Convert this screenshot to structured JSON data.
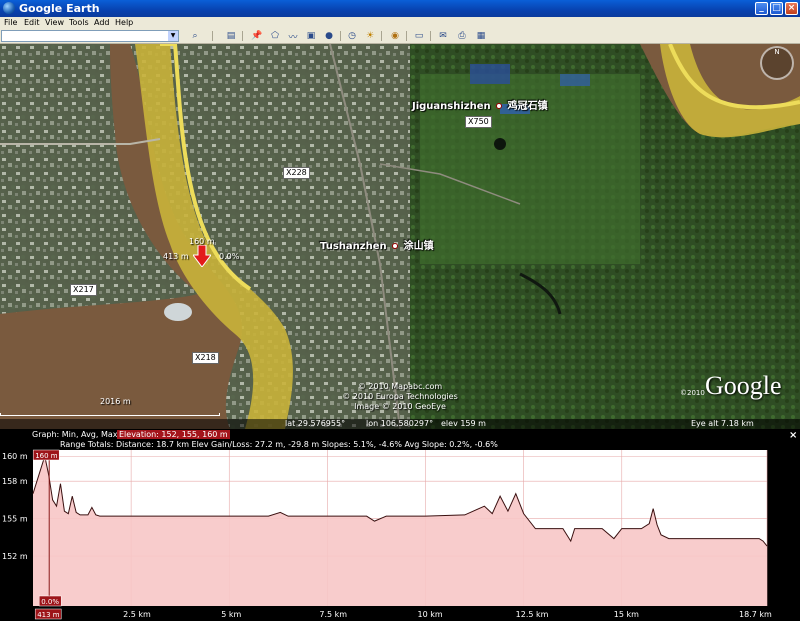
{
  "window": {
    "title": "Google Earth"
  },
  "menu": [
    "File",
    "Edit",
    "View",
    "Tools",
    "Add",
    "Help"
  ],
  "toolbar": {
    "search_value": "",
    "icons": [
      "search-icon",
      "sidebar-icon",
      "placemark-icon",
      "polygon-icon",
      "path-icon",
      "overlay-icon",
      "tour-icon",
      "history-icon",
      "sun-icon",
      "planet-icon",
      "ruler-icon",
      "email-icon",
      "print-icon",
      "maps-icon"
    ]
  },
  "map": {
    "places": [
      {
        "name": "Jiguanshizhen",
        "cn": "鸡冠石镇"
      },
      {
        "name": "Tushanzhen",
        "cn": "涂山镇"
      }
    ],
    "roads": [
      "X750",
      "X228",
      "X217",
      "X218"
    ],
    "marker": {
      "elevation": "160 m",
      "distance": "413 m",
      "slope": "0.0%"
    },
    "year_label": "2016 m",
    "credits": [
      "© 2010 Mapabc.com",
      "© 2010 Europa Technologies",
      "Image © 2010 GeoEye"
    ],
    "logo": "Google",
    "logo_year": "©2010",
    "compass_label": "N",
    "status": {
      "lat": "lat  29.576955°",
      "lon": "lon 106.580297°",
      "elev": "elev  159 m",
      "eye": "Eye alt    7.18 km"
    }
  },
  "elevation_panel": {
    "graph_line": "Graph: Min, Avg, Max",
    "graph_highlight": "Elevation: 152, 155, 160 m",
    "range_totals": "Range Totals: Distance: 18.7 km  Elev Gain/Loss: 27.2 m, -29.8 m  Slopes: 5.1%, -4.6%  Avg Slope: 0.2%, -0.6%",
    "cursor_top": "160 m",
    "cursor_bottom": "0.0%",
    "cursor_x": "413 m",
    "colors": {
      "fill": "#f7c6c6",
      "line": "#3a1010",
      "grid": "#e7a9a9"
    }
  },
  "chart_data": {
    "type": "area",
    "xlabel": "",
    "ylabel": "",
    "x_ticks": [
      "413 m",
      "2.5 km",
      "5 km",
      "7.5 km",
      "10 km",
      "12.5 km",
      "15 km",
      "18.7 km"
    ],
    "y_ticks": [
      "160 m",
      "158 m",
      "155 m",
      "152 m"
    ],
    "ylim": [
      148,
      160.5
    ],
    "xlim": [
      0,
      18.7
    ],
    "series": [
      {
        "name": "Elevation",
        "x": [
          0,
          0.15,
          0.3,
          0.4,
          0.5,
          0.6,
          0.7,
          0.8,
          0.9,
          1.0,
          1.1,
          1.2,
          1.3,
          1.4,
          1.5,
          1.6,
          1.7,
          2.0,
          3.0,
          4.0,
          5.0,
          6.0,
          6.3,
          6.5,
          7.0,
          7.5,
          8.0,
          8.5,
          8.7,
          9.0,
          10.0,
          11.0,
          11.5,
          11.7,
          11.9,
          12.1,
          12.3,
          12.5,
          12.8,
          13.5,
          13.7,
          13.8,
          14.0,
          14.5,
          14.8,
          15.0,
          15.2,
          15.5,
          15.7,
          15.8,
          15.9,
          16.0,
          16.2,
          16.5,
          17.0,
          17.5,
          18.0,
          18.3,
          18.5,
          18.6,
          18.7
        ],
        "values": [
          157,
          158.5,
          160,
          158.5,
          156.5,
          156,
          157.8,
          155.6,
          155.4,
          156.8,
          155.5,
          155.3,
          155.3,
          155.3,
          155.9,
          155.3,
          155.2,
          155.2,
          155.2,
          155.2,
          155.2,
          155.2,
          155.5,
          155.2,
          155.2,
          155.2,
          155.2,
          155.2,
          154.8,
          155.2,
          155.2,
          155.3,
          156,
          155.4,
          156.8,
          155.6,
          157,
          155.4,
          154.2,
          154.2,
          153.2,
          154.2,
          154.2,
          154.2,
          153.4,
          154.2,
          154.2,
          154.2,
          154.6,
          155.8,
          154.5,
          153.7,
          153.4,
          153.4,
          153.4,
          153.4,
          153.4,
          153.4,
          153.4,
          153.2,
          152.8
        ]
      }
    ],
    "cursor": {
      "x": 0.413,
      "elevation": 160,
      "slope": 0.0
    },
    "grid": true
  }
}
